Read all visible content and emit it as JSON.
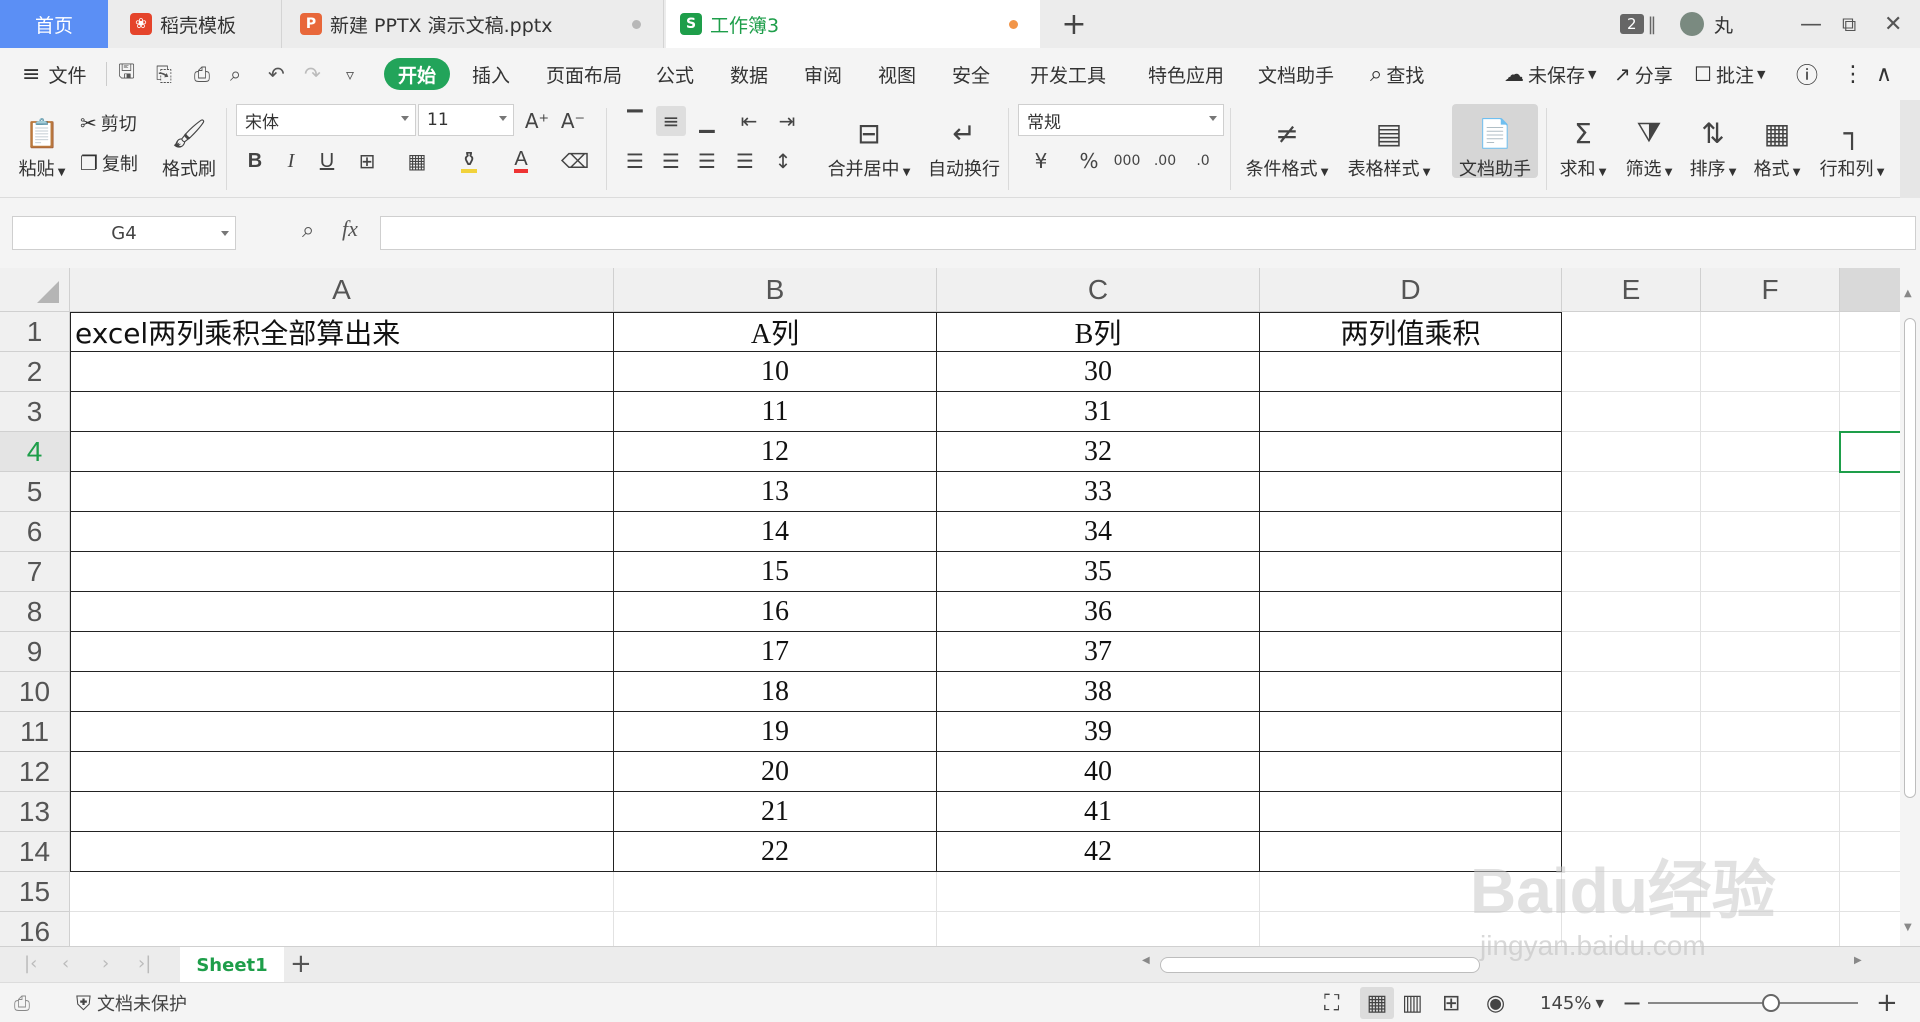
{
  "tabs": {
    "home": "首页",
    "daoke": "稻壳模板",
    "pptx": "新建 PPTX 演示文稿.pptx",
    "book": "工作簿3",
    "book_icon": "S",
    "pptx_icon": "P",
    "window_count": "2",
    "user_name": "丸"
  },
  "menu": {
    "file": "文件",
    "items": [
      "开始",
      "插入",
      "页面布局",
      "公式",
      "数据",
      "审阅",
      "视图",
      "安全",
      "开发工具",
      "特色应用",
      "文档助手"
    ],
    "search": "查找",
    "unsaved": "未保存",
    "share": "分享",
    "comment": "批注"
  },
  "ribbon": {
    "paste": "粘贴",
    "cut": "剪切",
    "copy": "复制",
    "format_painter": "格式刷",
    "font_name": "宋体",
    "font_size": "11",
    "merge_center": "合并居中",
    "wrap_text": "自动换行",
    "number_format": "常规",
    "cond_format": "条件格式",
    "table_style": "表格样式",
    "doc_assistant": "文档助手",
    "sum": "求和",
    "filter": "筛选",
    "sort": "排序",
    "format": "格式",
    "row_col": "行和列"
  },
  "formula_bar": {
    "cell_ref": "G4",
    "fx": "fx",
    "formula": ""
  },
  "grid": {
    "columns": [
      "A",
      "B",
      "C",
      "D",
      "E",
      "F"
    ],
    "rows": [
      "1",
      "2",
      "3",
      "4",
      "5",
      "6",
      "7",
      "8",
      "9",
      "10",
      "11",
      "12",
      "13",
      "14",
      "15",
      "16"
    ],
    "selected_row": "4",
    "cells": {
      "A1": "excel两列乘积全部算出来",
      "B1": "A列",
      "C1": "B列",
      "D1": "两列值乘积"
    },
    "col_a_values": [
      "10",
      "11",
      "12",
      "13",
      "14",
      "15",
      "16",
      "17",
      "18",
      "19",
      "20",
      "21",
      "22"
    ],
    "col_b_values": [
      "30",
      "31",
      "32",
      "33",
      "34",
      "35",
      "36",
      "37",
      "38",
      "39",
      "40",
      "41",
      "42"
    ]
  },
  "sheets": {
    "active": "Sheet1"
  },
  "status": {
    "protect": "文档未保护",
    "zoom": "145%"
  },
  "watermark": {
    "brand": "Baidu经验",
    "url": "jingyan.baidu.com"
  },
  "colors": {
    "accent_green": "#1e9e4a",
    "home_tab_blue": "#5b8ff5",
    "start_button": "#22a45a"
  }
}
